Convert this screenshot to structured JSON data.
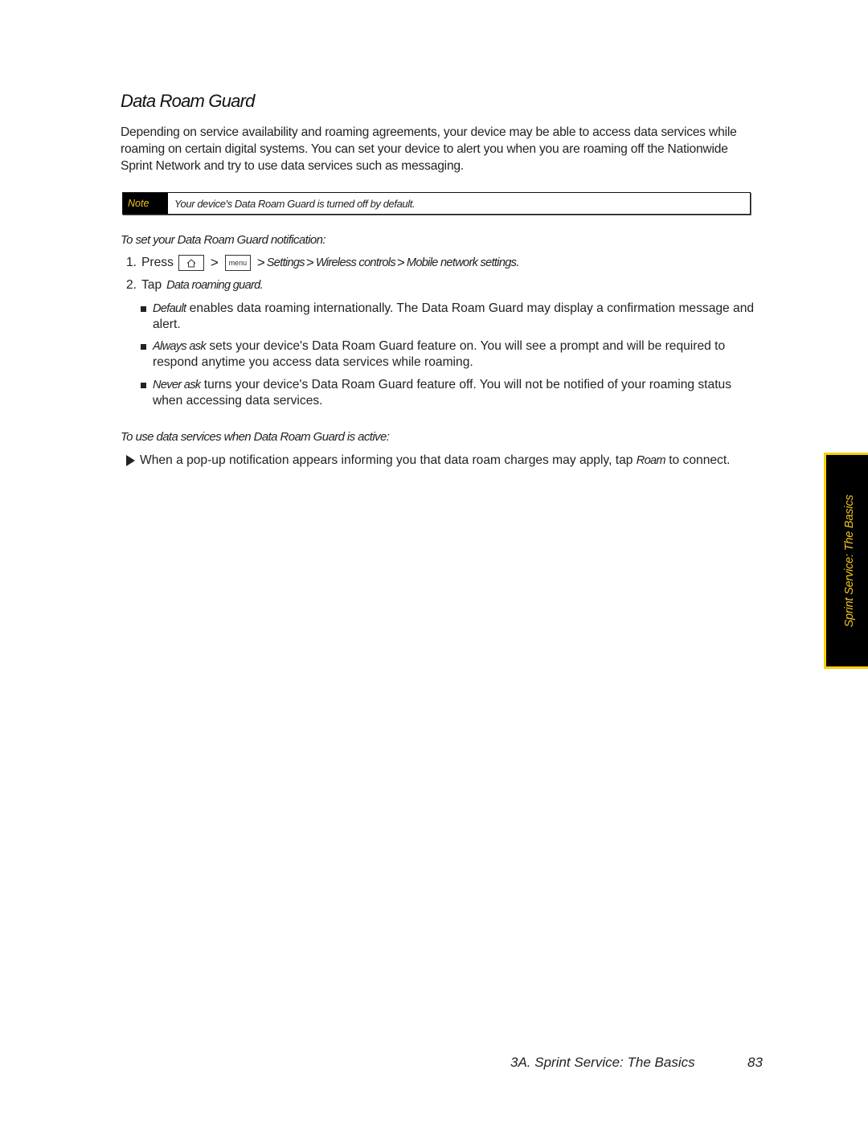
{
  "page": {
    "title": "Data Roam Guard",
    "intro": "Depending on service availability and roaming agreements, your device may be able to access data services while roaming on certain digital systems. You can set your device to alert you when you are roaming off the Nationwide Sprint Network and try to use data services such as messaging.",
    "note": {
      "label": "Note",
      "text": "Your device's Data Roam Guard is turned off by default."
    },
    "procedure1": {
      "heading": "To set your Data Roam Guard notification:",
      "step1": {
        "number": "1.",
        "prefix": "Press",
        "home_key_icon": "home-icon",
        "separator": ">",
        "menu_key_label": "menu",
        "path": [
          "Settings",
          "Wireless controls",
          "Mobile network settings."
        ]
      },
      "step2": {
        "number": "2.",
        "prefix": "Tap",
        "target": "Data roaming guard."
      },
      "options": [
        {
          "term": "Default",
          "text": " enables data roaming internationally. The Data Roam Guard may display a confirmation message and alert."
        },
        {
          "term": "Always ask",
          "text": " sets your device's Data Roam Guard feature on. You will see a prompt and will be required to respond anytime you access data services while roaming."
        },
        {
          "term": "Never ask",
          "text": " turns your device's Data Roam Guard feature off. You will not be notified of your roaming status when accessing data services."
        }
      ]
    },
    "procedure2": {
      "heading": "To use data services when Data Roam Guard is active:",
      "step": {
        "text_before": "When a pop-up notification appears informing you that data roam charges may apply, tap ",
        "term": "Roam",
        "text_after": " to connect."
      }
    },
    "side_tab": "Sprint Service: The Basics",
    "footer": {
      "section": "3A. Sprint Service: The Basics",
      "page_number": "83"
    },
    "colors": {
      "accent_yellow": "#f5d000",
      "tab_background": "#000000"
    }
  }
}
